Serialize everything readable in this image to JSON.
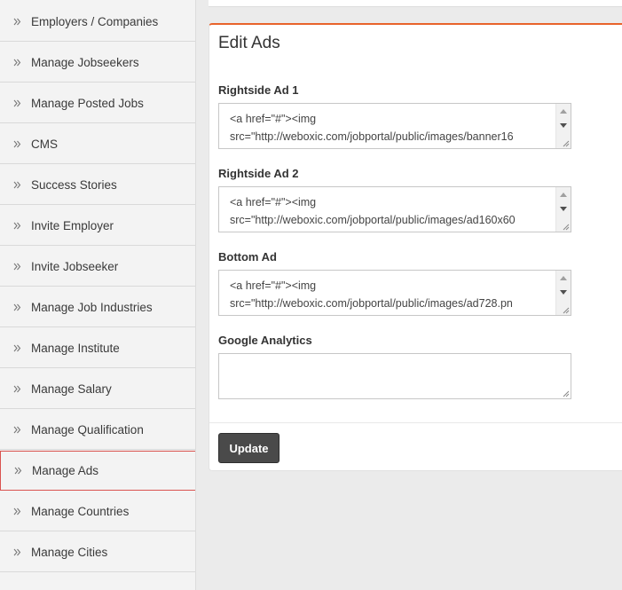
{
  "sidebar": {
    "items": [
      {
        "label": "Employers / Companies",
        "active": false
      },
      {
        "label": "Manage Jobseekers",
        "active": false
      },
      {
        "label": "Manage Posted Jobs",
        "active": false
      },
      {
        "label": "CMS",
        "active": false
      },
      {
        "label": "Success Stories",
        "active": false
      },
      {
        "label": "Invite Employer",
        "active": false
      },
      {
        "label": "Invite Jobseeker",
        "active": false
      },
      {
        "label": "Manage Job Industries",
        "active": false
      },
      {
        "label": "Manage Institute",
        "active": false
      },
      {
        "label": "Manage Salary",
        "active": false
      },
      {
        "label": "Manage Qualification",
        "active": false
      },
      {
        "label": "Manage Ads",
        "active": true
      },
      {
        "label": "Manage Countries",
        "active": false
      },
      {
        "label": "Manage Cities",
        "active": false
      }
    ],
    "icon": "double-chevron-right-icon"
  },
  "panel": {
    "title": "Edit Ads",
    "accent_color": "#e8632b",
    "fields": {
      "rightside_ad_1": {
        "label": "Rightside Ad 1",
        "line1": "<a href=\"#\"><img",
        "line2": "src=\"http://weboxic.com/jobportal/public/images/banner16"
      },
      "rightside_ad_2": {
        "label": "Rightside Ad 2",
        "line1": "<a href=\"#\"><img",
        "line2": "src=\"http://weboxic.com/jobportal/public/images/ad160x60"
      },
      "bottom_ad": {
        "label": "Bottom Ad",
        "line1": "<a href=\"#\"><img",
        "line2": "src=\"http://weboxic.com/jobportal/public/images/ad728.pn"
      },
      "google_analytics": {
        "label": "Google Analytics",
        "value": ""
      }
    },
    "update_label": "Update"
  }
}
